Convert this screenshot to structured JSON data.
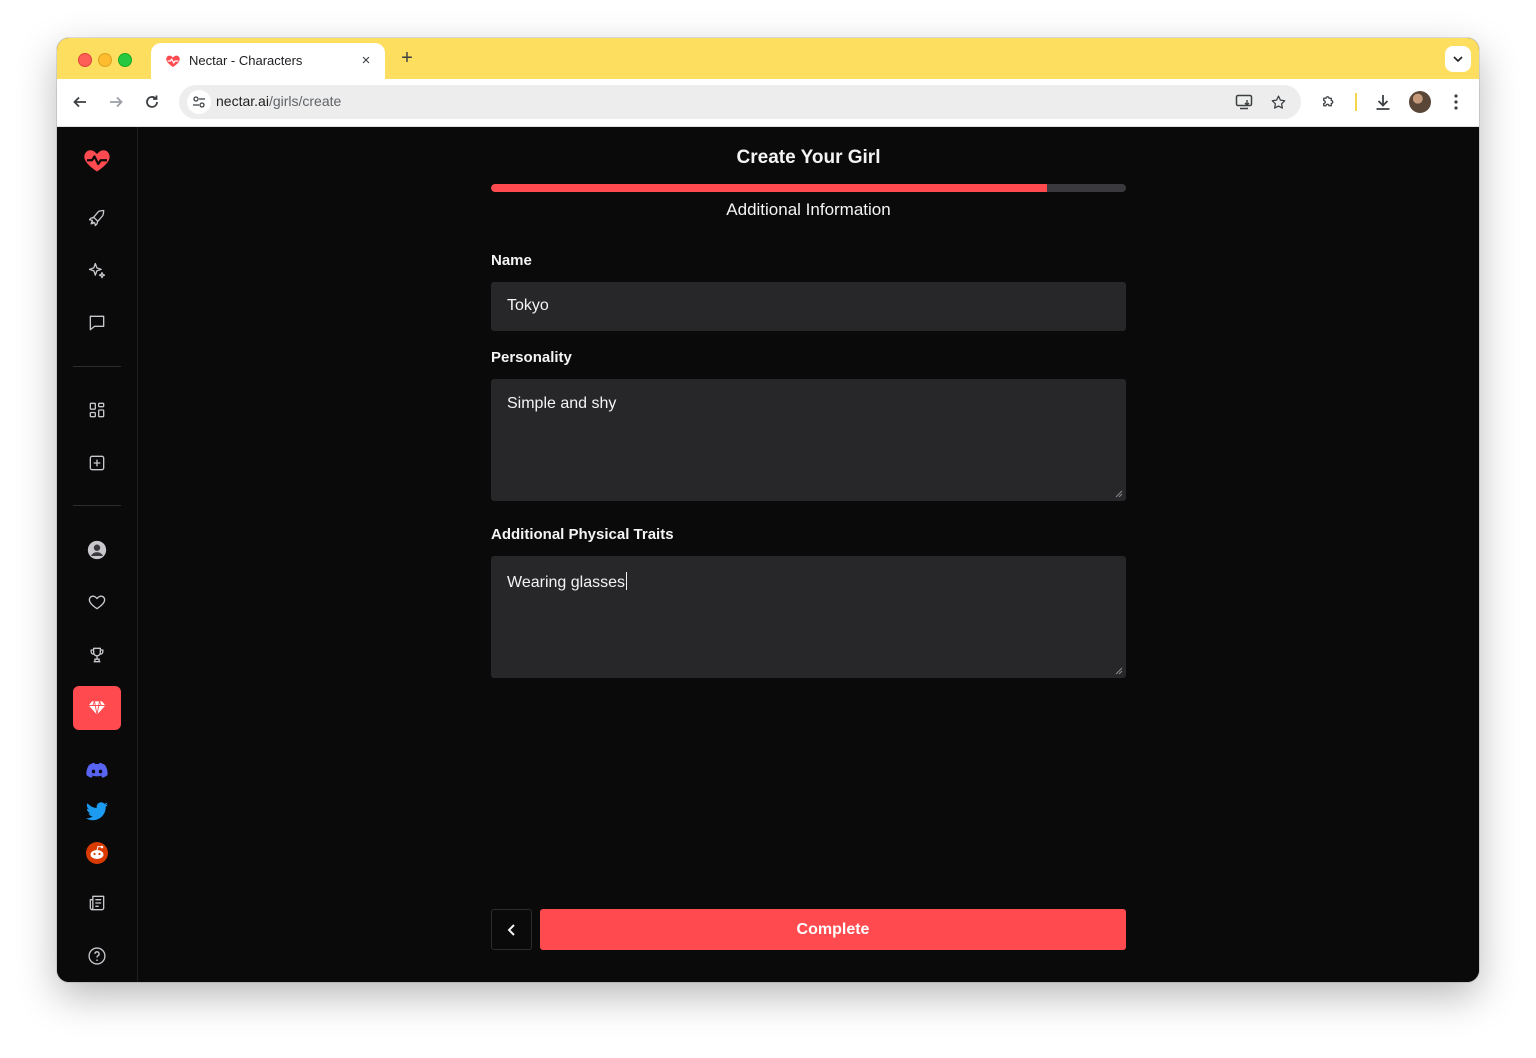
{
  "browser": {
    "tab_title": "Nectar - Characters",
    "tab_close": "×",
    "new_tab": "+",
    "url_host": "nectar.ai",
    "url_path": "/girls/create"
  },
  "sidebar": {
    "items": [
      {
        "name": "logo-heart-icon"
      },
      {
        "name": "rocket-icon"
      },
      {
        "name": "sparkles-icon"
      },
      {
        "name": "chat-icon"
      },
      {
        "name": "grid-icon"
      },
      {
        "name": "plus-square-icon"
      },
      {
        "name": "user-icon"
      },
      {
        "name": "heart-icon"
      },
      {
        "name": "trophy-icon"
      },
      {
        "name": "gem-icon",
        "active": true
      },
      {
        "name": "discord-icon"
      },
      {
        "name": "twitter-icon"
      },
      {
        "name": "reddit-icon"
      },
      {
        "name": "newspaper-icon"
      },
      {
        "name": "help-icon"
      }
    ]
  },
  "form": {
    "title": "Create Your Girl",
    "progress": 0.875,
    "step_title": "Additional Information",
    "name_label": "Name",
    "name_value": "Tokyo",
    "personality_label": "Personality",
    "personality_value": "Simple and shy",
    "traits_label": "Additional Physical Traits",
    "traits_value": "Wearing glasses",
    "complete_label": "Complete"
  },
  "colors": {
    "accent": "#ff4b4f",
    "background": "#0a0a0b",
    "field": "#27272a",
    "tabstrip": "#fdde5e"
  }
}
